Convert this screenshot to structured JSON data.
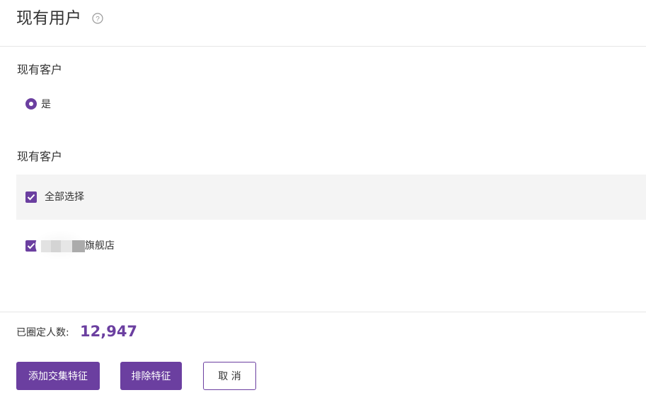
{
  "header": {
    "title": "现有用户",
    "help_icon": "question-circle-icon"
  },
  "section1": {
    "label": "现有客户",
    "radio_option": "是",
    "radio_selected": true
  },
  "section2": {
    "label": "现有客户",
    "select_all_label": "全部选择",
    "select_all_checked": true,
    "items": [
      {
        "label_suffix": "旗舰店",
        "checked": true
      }
    ]
  },
  "summary": {
    "label": "已圈定人数:",
    "count": "12,947"
  },
  "buttons": {
    "add_intersection": "添加交集特征",
    "exclude": "排除特征",
    "cancel": "取 消"
  },
  "colors": {
    "accent": "#6b3fa0",
    "divider": "#e6e6e6",
    "row_bg": "#f4f4f4"
  }
}
